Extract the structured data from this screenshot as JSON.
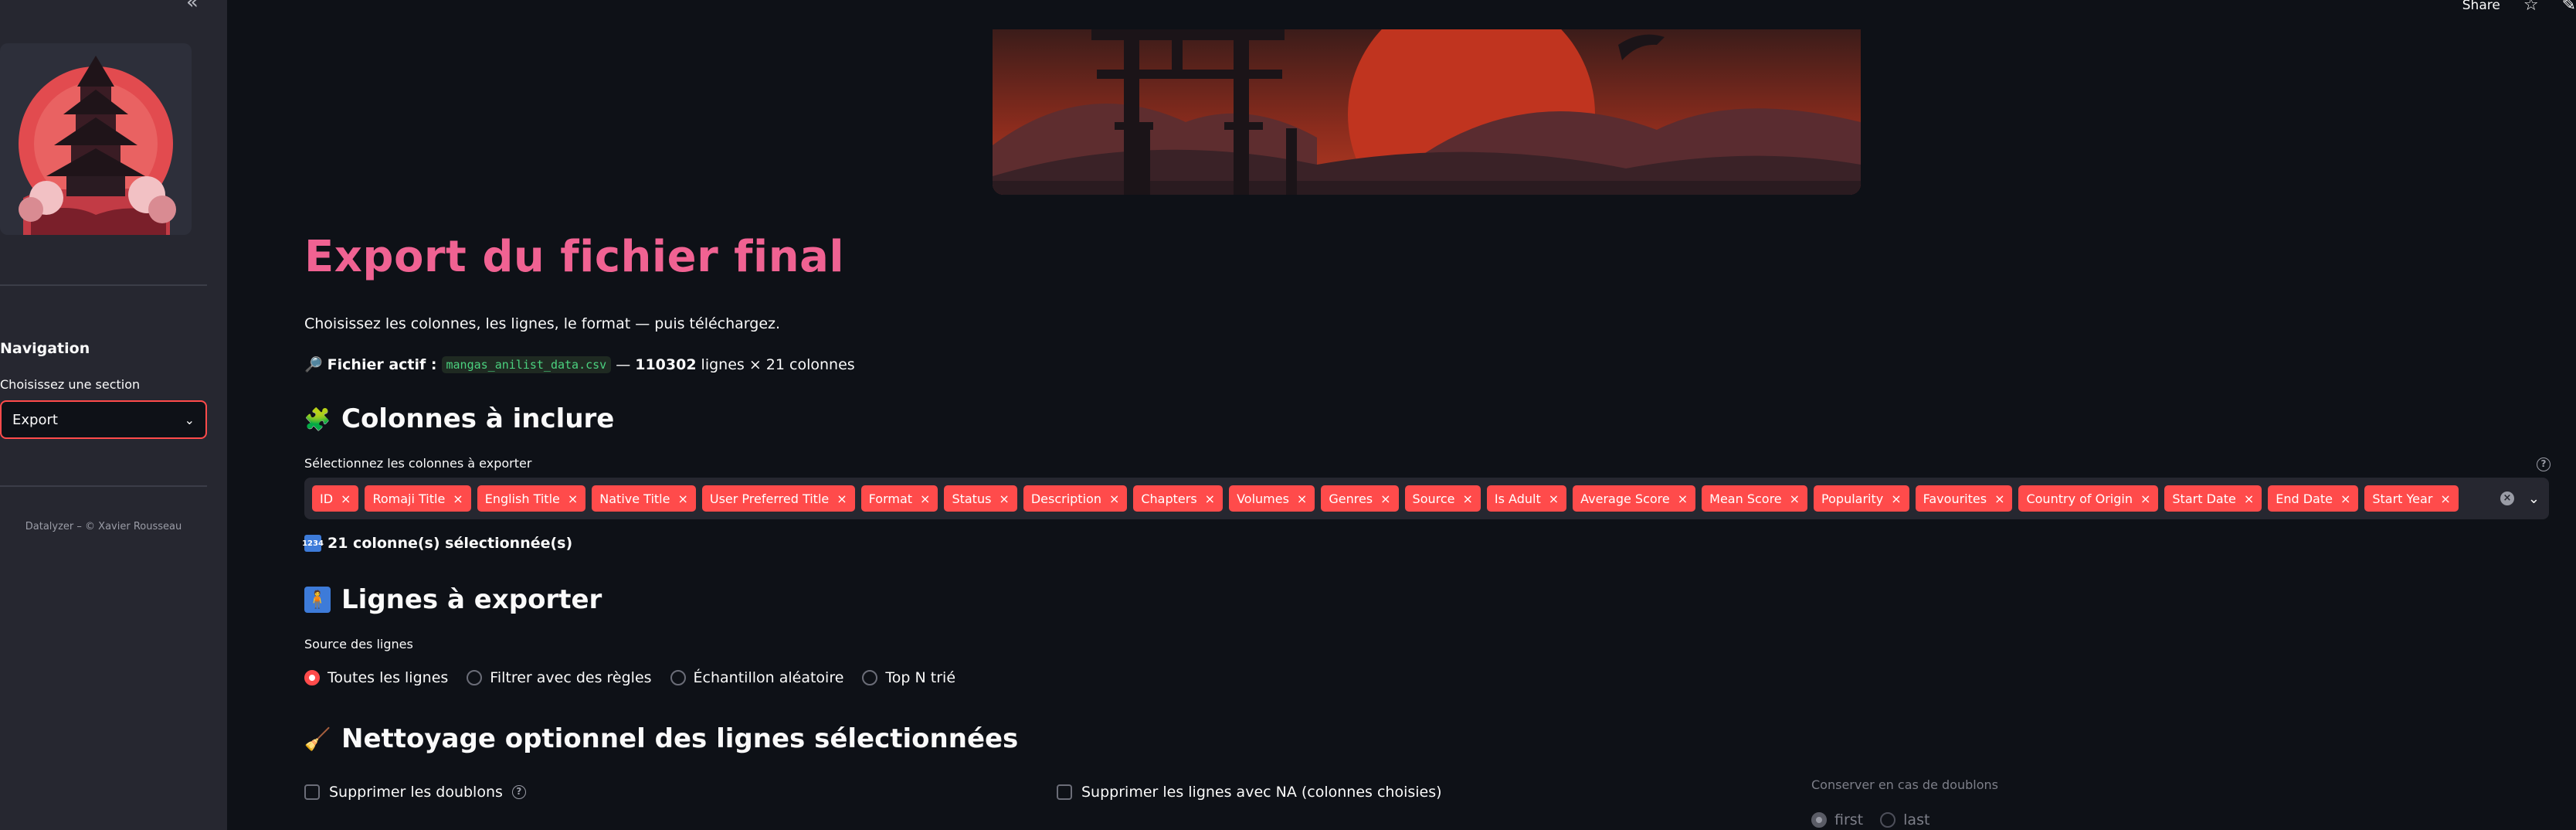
{
  "topbar": {
    "share_label": "Share"
  },
  "sidebar": {
    "nav_title": "Navigation",
    "select_label": "Choisissez une section",
    "select_value": "Export",
    "footer": "Datalyzer – © Xavier Rousseau"
  },
  "page": {
    "title": "Export du fichier final",
    "intro": "Choisissez les colonnes, les lignes, le format — puis téléchargez.",
    "active_file_label": "Fichier actif :",
    "active_file_name": "mangas_anilist_data.csv",
    "active_file_sep": "—",
    "rows_count": "110302",
    "rows_suffix": "lignes × 21 colonnes"
  },
  "columns_section": {
    "heading": "Colonnes à inclure",
    "label": "Sélectionnez les colonnes à exporter",
    "tags": [
      "ID",
      "Romaji Title",
      "English Title",
      "Native Title",
      "User Preferred Title",
      "Format",
      "Status",
      "Description",
      "Chapters",
      "Volumes",
      "Genres",
      "Source",
      "Is Adult",
      "Average Score",
      "Mean Score",
      "Popularity",
      "Favourites",
      "Country of Origin",
      "Start Date",
      "End Date",
      "Start Year"
    ],
    "count_text": "21 colonne(s) sélectionnée(s)",
    "count_badge": "1234"
  },
  "rows_section": {
    "heading": "Lignes à exporter",
    "label": "Source des lignes",
    "options": [
      "Toutes les lignes",
      "Filtrer avec des règles",
      "Échantillon aléatoire",
      "Top N trié"
    ],
    "selected_index": 0
  },
  "cleaning_section": {
    "heading": "Nettoyage optionnel des lignes sélectionnées",
    "remove_duplicates": "Supprimer les doublons",
    "remove_na": "Supprimer les lignes avec NA (colonnes choisies)",
    "keep_label": "Conserver en cas de doublons",
    "keep_options": [
      "first",
      "last"
    ]
  },
  "colors": {
    "accent": "#ff4b4b",
    "title_pink": "#f06292",
    "background": "#0e1117",
    "sidebar": "#262730"
  },
  "icons": [
    "collapse-sidebar-icon",
    "star-icon",
    "magnifier-icon",
    "puzzle-icon",
    "person-icon",
    "broom-icon",
    "help-icon",
    "chevron-down-icon",
    "clear-icon"
  ]
}
